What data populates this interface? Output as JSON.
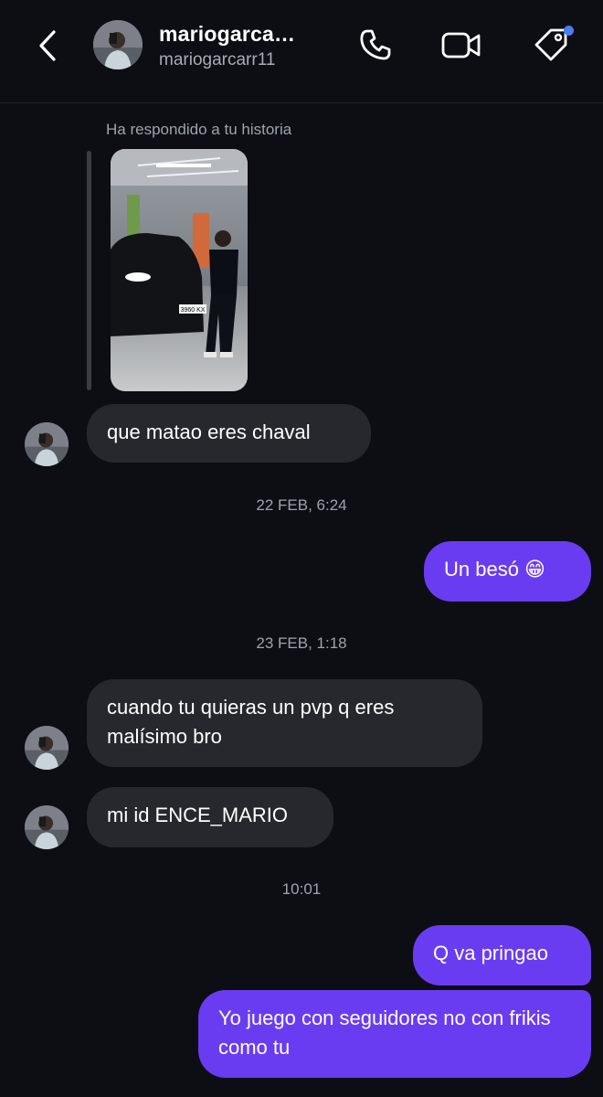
{
  "header": {
    "display_name": "mariogarca…",
    "username": "mariogarcarr11",
    "icons": [
      "back-chevron-icon",
      "phone-icon",
      "video-camera-icon",
      "tag-icon"
    ],
    "accent": "#4c7bf2"
  },
  "story_reply": {
    "label": "Ha respondido a tu historia",
    "plate_text": "3960 KX"
  },
  "messages": [
    {
      "side": "in",
      "text": "que matao eres chaval"
    },
    {
      "timestamp": "22 FEB, 6:24"
    },
    {
      "side": "out",
      "text": "Un besó 😁"
    },
    {
      "timestamp": "23 FEB, 1:18"
    },
    {
      "side": "in",
      "text": "cuando tu quieras un pvp q eres malísimo bro"
    },
    {
      "side": "in",
      "text": "mi id ENCE_MARIO"
    },
    {
      "timestamp": "10:01"
    },
    {
      "side": "out",
      "text": "Q va pringao"
    },
    {
      "side": "out",
      "text": "Yo juego con seguidores no con frikis como tu"
    }
  ],
  "colors": {
    "background": "#0c0e14",
    "incoming_bubble": "#26282e",
    "outgoing_bubble": "#6a3cf1"
  }
}
